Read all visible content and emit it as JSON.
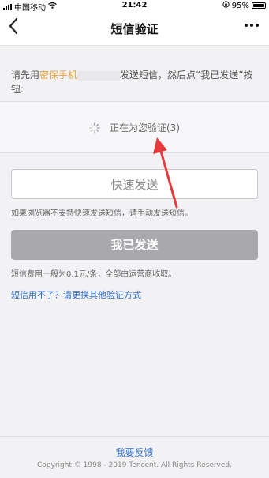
{
  "status_bar": {
    "carrier": "中国移动",
    "time": "21:42",
    "battery": "95%"
  },
  "nav": {
    "title": "短信验证",
    "back_icon": "chevron-left-icon",
    "more_icon": "more-dots-icon"
  },
  "instruction": {
    "prefix": "请先用",
    "highlight": "密保手机",
    "suffix": "发送短信，然后点“我已发送”按钮:"
  },
  "verify": {
    "status_text": "正在为您验证(3)",
    "spinner_icon": "loading-spinner-icon"
  },
  "buttons": {
    "quick_send": "快速发送",
    "already_sent": "我已发送"
  },
  "notes": {
    "browser_note": "如果浏览器不支持快速发送短信，请手动发送短信。",
    "fee_note": "短信费用一般为0.1元/条，全部由运营商收取。"
  },
  "links": {
    "alternative": "短信用不了？请更换其他验证方式"
  },
  "footer": {
    "feedback": "我要反馈",
    "copyright": "Copyright © 1998 - 2019 Tencent. All Rights Reserved."
  },
  "colors": {
    "highlight": "#e6a23c",
    "link": "#2f6ec8",
    "annotation_arrow": "#e5393b"
  }
}
